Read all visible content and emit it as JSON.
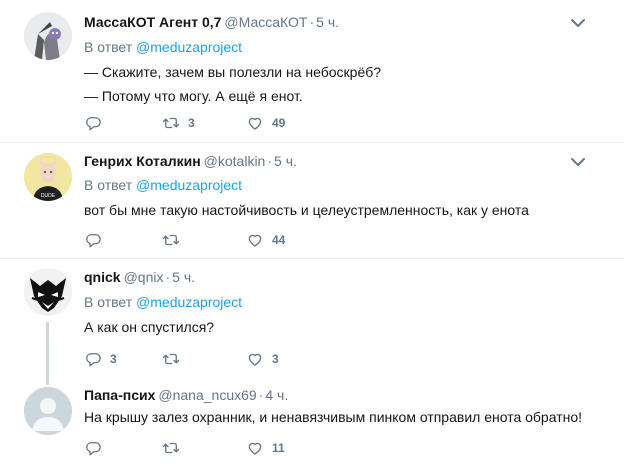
{
  "reply_prefix": "В ответ",
  "tweets": [
    {
      "name": "МассаКОТ Агент 0,7",
      "handle": "@МассаКОТ",
      "time": "5 ч.",
      "reply_to": "@meduzaproject",
      "lines": [
        "— Скажите, зачем вы полезли на небоскрёб?",
        "— Потому что могу. А ещё я енот."
      ],
      "retweets": "3",
      "likes": "49",
      "replies": ""
    },
    {
      "name": "Генрих Коталкин",
      "handle": "@kotalkin",
      "time": "5 ч.",
      "reply_to": "@meduzaproject",
      "lines": [
        "вот бы мне такую настойчивость и целеустремленность, как у енота"
      ],
      "retweets": "",
      "likes": "44",
      "replies": "",
      "avatar_shirt_text": "DUDE"
    },
    {
      "name": "qnick",
      "handle": "@qnix",
      "time": "5 ч.",
      "reply_to": "@meduzaproject",
      "lines": [
        "А как он спустился?"
      ],
      "retweets": "",
      "likes": "3",
      "replies": "3"
    },
    {
      "name": "Папа-псих",
      "handle": "@nana_ncux69",
      "time": "4 ч.",
      "lines": [
        "На крышу залез охранник, и ненавязчивым пинком отправил енота обратно!"
      ],
      "retweets": "",
      "likes": "11",
      "replies": ""
    }
  ],
  "colors": {
    "accent": "#1da1f2",
    "secondary_text": "#657786",
    "divider": "#e6ecf0",
    "thread_line": "#ccd6dd"
  },
  "icons": [
    "reply-icon",
    "retweet-icon",
    "like-icon",
    "chevron-down-icon"
  ]
}
